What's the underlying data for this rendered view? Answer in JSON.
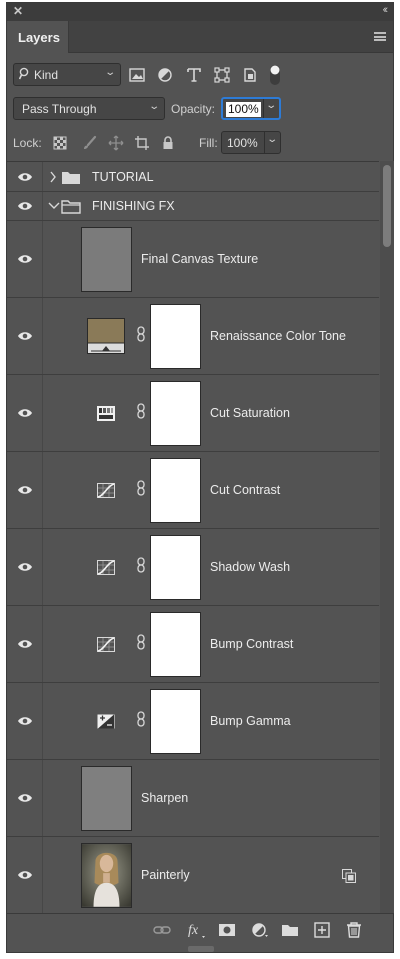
{
  "panel": {
    "tab_label": "Layers"
  },
  "filter": {
    "kind_value": "Kind"
  },
  "blend": {
    "mode_value": "Pass Through",
    "opacity_label": "Opacity:",
    "opacity_value": "100%"
  },
  "lock": {
    "label": "Lock:",
    "fill_label": "Fill:",
    "fill_value": "100%"
  },
  "layers": [
    {
      "name": "TUTORIAL",
      "kind": "group",
      "expanded": false
    },
    {
      "name": "FINISHING FX",
      "kind": "group",
      "expanded": true
    },
    {
      "name": "Final Canvas Texture",
      "kind": "pixel"
    },
    {
      "name": "Renaissance Color Tone",
      "kind": "solid-color-fill",
      "color": "#8a7a58"
    },
    {
      "name": "Cut Saturation",
      "kind": "hue-saturation-adjustment"
    },
    {
      "name": "Cut Contrast",
      "kind": "curves-adjustment"
    },
    {
      "name": "Shadow Wash",
      "kind": "curves-adjustment"
    },
    {
      "name": "Bump Contrast",
      "kind": "curves-adjustment"
    },
    {
      "name": "Bump Gamma",
      "kind": "exposure-adjustment"
    },
    {
      "name": "Sharpen",
      "kind": "pixel"
    },
    {
      "name": "Painterly",
      "kind": "smart-object"
    }
  ],
  "icons": {
    "close": "close-icon",
    "collapse": "double-chevron-left-icon",
    "menu": "panel-menu-icon",
    "visibility": "eye-icon",
    "link": "chain-link-icon",
    "folder": "folder-icon"
  },
  "colors": {
    "panel_bg": "#535353",
    "accent": "#2d7bd6"
  }
}
